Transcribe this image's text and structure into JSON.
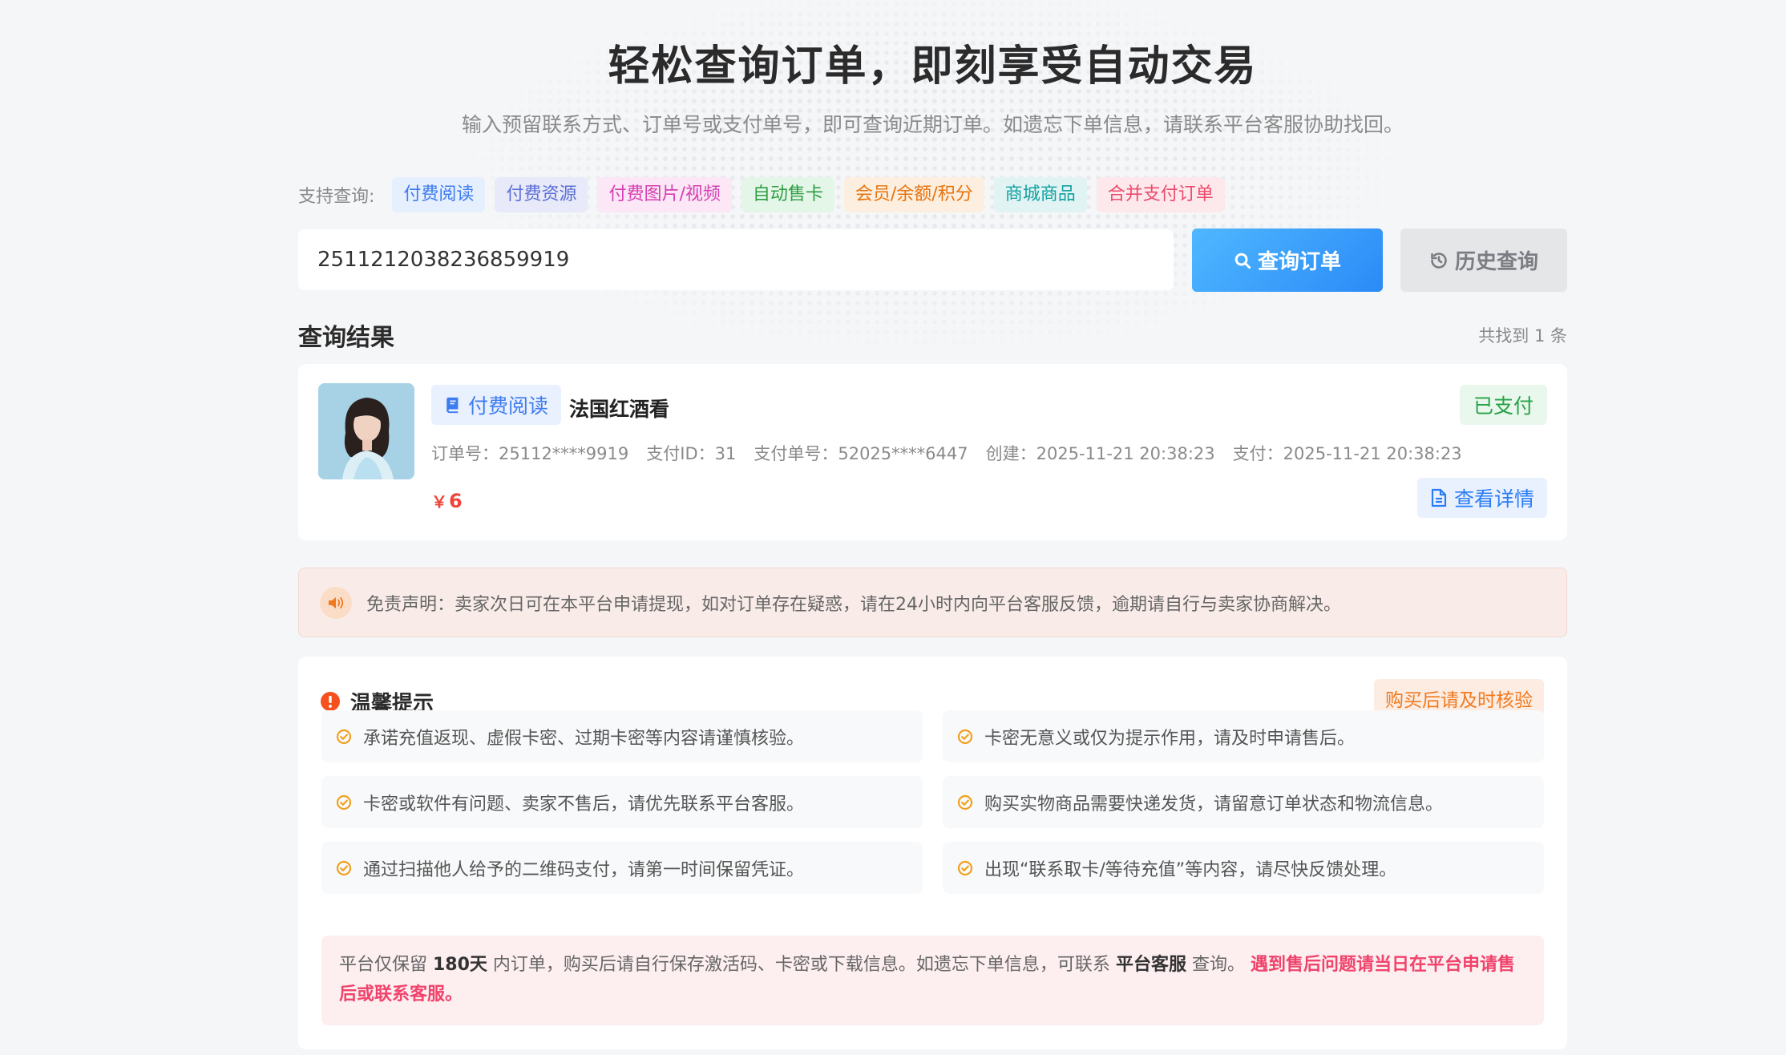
{
  "hero": {
    "title": "轻松查询订单，即刻享受自动交易",
    "subtitle": "输入预留联系方式、订单号或支付单号，即可查询近期订单。如遗忘下单信息，请联系平台客服协助找回。"
  },
  "support": {
    "label": "支持查询:",
    "tags": [
      {
        "label": "付费阅读",
        "color": "#3d7cf0",
        "bg": "#e6effd"
      },
      {
        "label": "付费资源",
        "color": "#5b6fd6",
        "bg": "#e8eaf9"
      },
      {
        "label": "付费图片/视频",
        "color": "#d63fb4",
        "bg": "#fbe7f5"
      },
      {
        "label": "自动售卡",
        "color": "#2f9e44",
        "bg": "#e4f6e7"
      },
      {
        "label": "会员/余额/积分",
        "color": "#e8730c",
        "bg": "#fdefe0"
      },
      {
        "label": "商城商品",
        "color": "#14a0a0",
        "bg": "#e1f4f3"
      },
      {
        "label": "合并支付订单",
        "color": "#ec4a6b",
        "bg": "#fde8ec"
      }
    ]
  },
  "search": {
    "value": "2511212038236859919",
    "query_label": "查询订单",
    "history_label": "历史查询"
  },
  "results": {
    "title": "查询结果",
    "count_text": "共找到 1 条"
  },
  "order": {
    "type_label": "付费阅读",
    "name": "法国红酒看",
    "status": "已支付",
    "meta": {
      "order_no": "订单号：25112****9919",
      "pay_id": "支付ID：31",
      "pay_no": "支付单号：52025****6447",
      "created": "创建：2025-11-21 20:38:23",
      "paid": "支付：2025-11-21 20:38:23"
    },
    "currency": "￥",
    "price": "6",
    "detail_label": "查看详情"
  },
  "disclaimer": {
    "text": "免责声明：卖家次日可在本平台申请提现，如对订单存在疑惑，请在24小时内向平台客服反馈，逾期请自行与卖家协商解决。"
  },
  "tips": {
    "title": "温馨提示",
    "badge": "购买后请及时核验",
    "items": [
      "承诺充值返现、虚假卡密、过期卡密等内容请谨慎核验。",
      "卡密无意义或仅为提示作用，请及时申请售后。",
      "卡密或软件有问题、卖家不售后，请优先联系平台客服。",
      "购买实物商品需要快递发货，请留意订单状态和物流信息。",
      "通过扫描他人给予的二维码支付，请第一时间保留凭证。",
      "出现“联系取卡/等待充值”等内容，请尽快反馈处理。"
    ],
    "retention": {
      "p1": "平台仅保留 ",
      "days": "180天",
      "p2": " 内订单，购买后请自行保存激活码、卡密或下载信息。如遗忘下单信息，可联系 ",
      "service": "平台客服",
      "p3": " 查询。 ",
      "warn": "遇到售后问题请当日在平台申请售后或联系客服。"
    }
  }
}
